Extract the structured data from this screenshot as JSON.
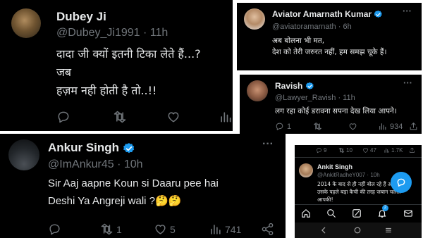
{
  "tweets": {
    "dubey": {
      "name": "Dubey Ji",
      "handle": "@Dubey_Ji1991",
      "sep": "·",
      "time": "11h",
      "text": "दादा जी क्यों इतनी टिका लेते हैं...?\nजब\nहज़म नही होती है तो..!!"
    },
    "aviator": {
      "name": "Aviator Amarnath Kumar",
      "handle": "@aviatoramarnath",
      "sep": "·",
      "time": "6h",
      "text": "अब बोलना भी मत,\nदेश को तेरी जरुरत नहीं, हम समझ चूके हैं।"
    },
    "ravish": {
      "name": "Ravish",
      "handle": "@Lawyer_Ravish",
      "sep": "·",
      "time": "11h",
      "text": "लग रहा कोई डरावना सपना देख लिया आपने।",
      "replies": "1",
      "views": "934"
    },
    "ankur": {
      "name": "Ankur Singh",
      "handle": "@ImAnkur45",
      "sep": "·",
      "time": "10h",
      "text": "Sir Aaj aapne Koun si Daaru pee hai\nDeshi Ya Angreji wali ?🤔🤔",
      "retweets": "1",
      "likes": "5",
      "views": "741"
    },
    "ankit": {
      "top_replies": "9",
      "top_retweets": "10",
      "top_likes": "47",
      "top_views": "1.7K",
      "name": "Ankit Singh",
      "handle": "@AnkitRadheY007",
      "sep": "·",
      "time": "10h",
      "text": "2014 के बाद से ही नहीं बोल रहे हैं आप\nउसके पहले बड़ा कैची की तरह जबान चलता\nआपकी!"
    }
  },
  "colors": {
    "background": "#000000",
    "text": "#e7e9ea",
    "muted": "#71767b",
    "verified": "#1d9bf0",
    "accent": "#1d9bf0"
  },
  "icons": [
    "reply-icon",
    "retweet-icon",
    "like-icon",
    "views-icon",
    "share-icon",
    "more-icon",
    "verified-icon",
    "home-icon",
    "search-icon",
    "grok-icon",
    "notifications-icon",
    "messages-icon",
    "compose-icon",
    "back-icon",
    "home-circle-icon",
    "recents-icon"
  ],
  "notifications_badge": "2"
}
